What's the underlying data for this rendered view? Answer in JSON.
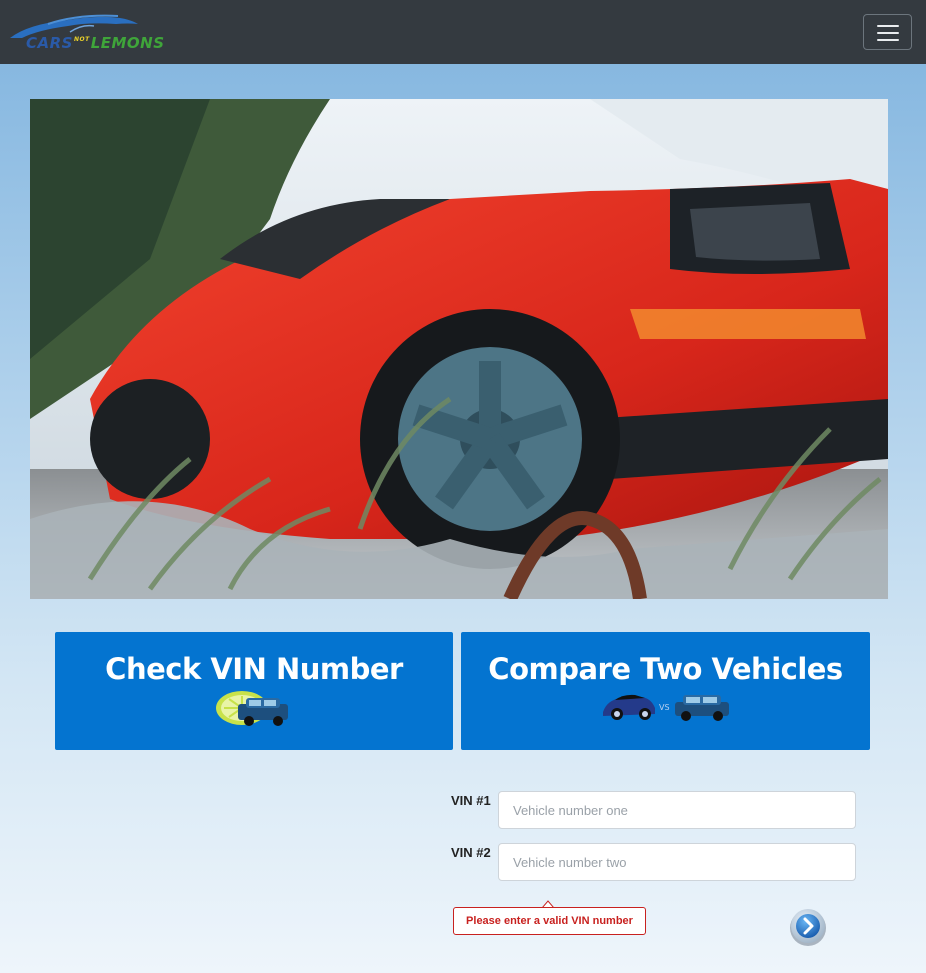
{
  "navbar": {
    "logo": {
      "brand_word_1": "CARS",
      "brand_word_2": "NOT",
      "brand_word_3": "LEMONS"
    },
    "menu_toggle": "hamburger-menu-icon"
  },
  "tiles": {
    "check_vin": {
      "label": "Check VIN Number",
      "icon": "lime-and-car-icon"
    },
    "compare": {
      "label": "Compare Two Vehicles",
      "icon": "car-vs-car-icon"
    }
  },
  "form": {
    "vin1": {
      "label": "VIN #1",
      "placeholder": "Vehicle number one",
      "value": ""
    },
    "vin2": {
      "label": "VIN #2",
      "placeholder": "Vehicle number two",
      "value": ""
    },
    "error": "Please enter a valid VIN number",
    "submit_icon": "next-arrow-icon"
  },
  "colors": {
    "navbar": "#343a40",
    "tile_blue": "#0474d0",
    "error_red": "#c8211f"
  }
}
